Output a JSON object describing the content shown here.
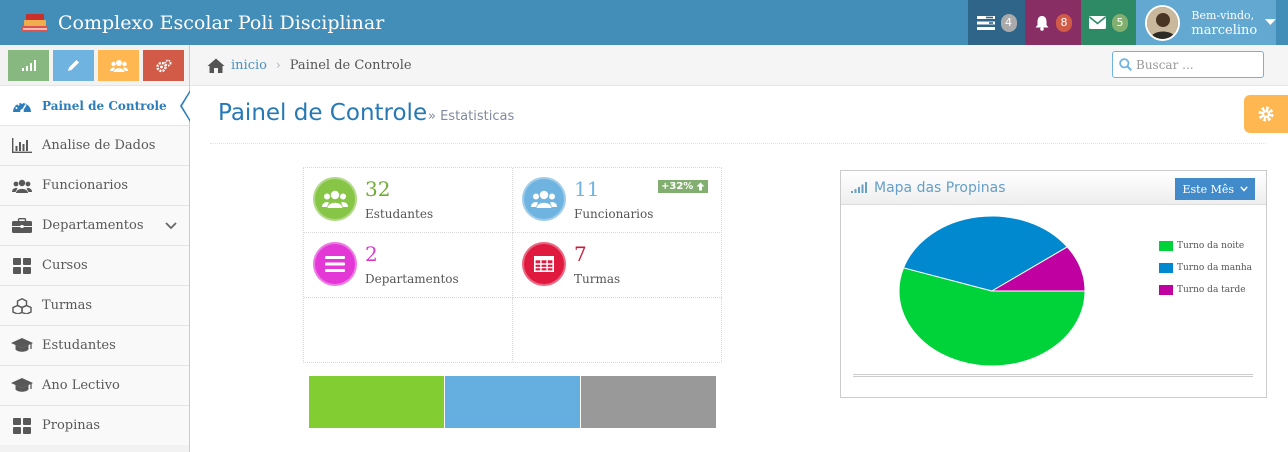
{
  "app": {
    "title": "Complexo Escolar Poli Disciplinar"
  },
  "navbar": {
    "tasks_count": "4",
    "notifications_count": "8",
    "messages_count": "5",
    "user": {
      "welcome": "Bem-vindo,",
      "name": "marcelino"
    }
  },
  "sidebar": {
    "shortcuts": [
      {
        "icon": "signal-icon",
        "color": "#87b87f"
      },
      {
        "icon": "pencil-icon",
        "color": "#6fb3e0"
      },
      {
        "icon": "group-icon",
        "color": "#ffb752"
      },
      {
        "icon": "cogs-icon",
        "color": "#d15b47"
      }
    ],
    "items": [
      {
        "label": "Painel de Controle",
        "icon": "dashboard-icon",
        "active": true
      },
      {
        "label": "Analise de Dados",
        "icon": "bar-chart-icon"
      },
      {
        "label": "Funcionarios",
        "icon": "users-icon"
      },
      {
        "label": "Departamentos",
        "icon": "briefcase-icon",
        "has_submenu": true
      },
      {
        "label": "Cursos",
        "icon": "grid-icon"
      },
      {
        "label": "Turmas",
        "icon": "cubes-icon"
      },
      {
        "label": "Estudantes",
        "icon": "graduation-cap-icon"
      },
      {
        "label": "Ano Lectivo",
        "icon": "graduation-cap-icon"
      },
      {
        "label": "Propinas",
        "icon": "grid-icon"
      }
    ]
  },
  "breadcrumb": {
    "home": "inicio",
    "current": "Painel de Controle"
  },
  "search": {
    "placeholder": "Buscar ..."
  },
  "page": {
    "title": "Painel de Controle",
    "subtitle": "» Estatisticas"
  },
  "infoboxes": [
    {
      "value": "32",
      "label": "Estudantes",
      "color": "#6fb3e0"
    },
    {
      "value": "11",
      "label": "Funcionarios",
      "badge": "+32%"
    },
    {
      "value": "2",
      "label": "Departamentos"
    },
    {
      "value": "7",
      "label": "Turmas"
    }
  ],
  "widget": {
    "title": "Mapa das Propinas",
    "dropdown": "Este Mês",
    "chart_data": {
      "type": "pie",
      "series": [
        {
          "name": "Turno da noite",
          "value": 55,
          "color": "#00d33a"
        },
        {
          "name": "Turno da manha",
          "value": 35,
          "color": "#0089cf"
        },
        {
          "name": "Turno da tarde",
          "value": 10,
          "color": "#c000a0"
        }
      ]
    }
  },
  "strip_colors": [
    "#82cd31",
    "#65aee0",
    "#999999"
  ]
}
